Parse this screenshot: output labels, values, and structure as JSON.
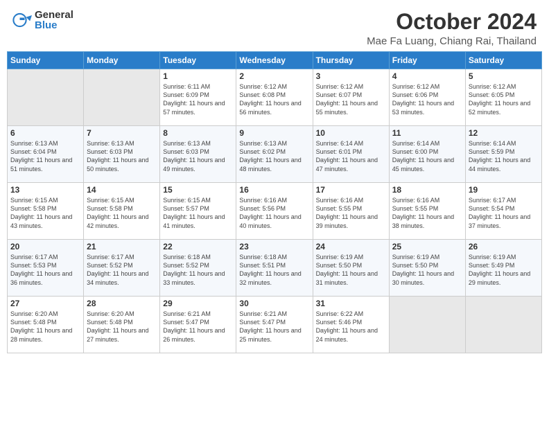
{
  "header": {
    "logo_general": "General",
    "logo_blue": "Blue",
    "title": "October 2024",
    "subtitle": "Mae Fa Luang, Chiang Rai, Thailand"
  },
  "days_of_week": [
    "Sunday",
    "Monday",
    "Tuesday",
    "Wednesday",
    "Thursday",
    "Friday",
    "Saturday"
  ],
  "weeks": [
    [
      {
        "day": null
      },
      {
        "day": null
      },
      {
        "day": "1",
        "sunrise": "Sunrise: 6:11 AM",
        "sunset": "Sunset: 6:09 PM",
        "daylight": "Daylight: 11 hours and 57 minutes."
      },
      {
        "day": "2",
        "sunrise": "Sunrise: 6:12 AM",
        "sunset": "Sunset: 6:08 PM",
        "daylight": "Daylight: 11 hours and 56 minutes."
      },
      {
        "day": "3",
        "sunrise": "Sunrise: 6:12 AM",
        "sunset": "Sunset: 6:07 PM",
        "daylight": "Daylight: 11 hours and 55 minutes."
      },
      {
        "day": "4",
        "sunrise": "Sunrise: 6:12 AM",
        "sunset": "Sunset: 6:06 PM",
        "daylight": "Daylight: 11 hours and 53 minutes."
      },
      {
        "day": "5",
        "sunrise": "Sunrise: 6:12 AM",
        "sunset": "Sunset: 6:05 PM",
        "daylight": "Daylight: 11 hours and 52 minutes."
      }
    ],
    [
      {
        "day": "6",
        "sunrise": "Sunrise: 6:13 AM",
        "sunset": "Sunset: 6:04 PM",
        "daylight": "Daylight: 11 hours and 51 minutes."
      },
      {
        "day": "7",
        "sunrise": "Sunrise: 6:13 AM",
        "sunset": "Sunset: 6:03 PM",
        "daylight": "Daylight: 11 hours and 50 minutes."
      },
      {
        "day": "8",
        "sunrise": "Sunrise: 6:13 AM",
        "sunset": "Sunset: 6:03 PM",
        "daylight": "Daylight: 11 hours and 49 minutes."
      },
      {
        "day": "9",
        "sunrise": "Sunrise: 6:13 AM",
        "sunset": "Sunset: 6:02 PM",
        "daylight": "Daylight: 11 hours and 48 minutes."
      },
      {
        "day": "10",
        "sunrise": "Sunrise: 6:14 AM",
        "sunset": "Sunset: 6:01 PM",
        "daylight": "Daylight: 11 hours and 47 minutes."
      },
      {
        "day": "11",
        "sunrise": "Sunrise: 6:14 AM",
        "sunset": "Sunset: 6:00 PM",
        "daylight": "Daylight: 11 hours and 45 minutes."
      },
      {
        "day": "12",
        "sunrise": "Sunrise: 6:14 AM",
        "sunset": "Sunset: 5:59 PM",
        "daylight": "Daylight: 11 hours and 44 minutes."
      }
    ],
    [
      {
        "day": "13",
        "sunrise": "Sunrise: 6:15 AM",
        "sunset": "Sunset: 5:58 PM",
        "daylight": "Daylight: 11 hours and 43 minutes."
      },
      {
        "day": "14",
        "sunrise": "Sunrise: 6:15 AM",
        "sunset": "Sunset: 5:58 PM",
        "daylight": "Daylight: 11 hours and 42 minutes."
      },
      {
        "day": "15",
        "sunrise": "Sunrise: 6:15 AM",
        "sunset": "Sunset: 5:57 PM",
        "daylight": "Daylight: 11 hours and 41 minutes."
      },
      {
        "day": "16",
        "sunrise": "Sunrise: 6:16 AM",
        "sunset": "Sunset: 5:56 PM",
        "daylight": "Daylight: 11 hours and 40 minutes."
      },
      {
        "day": "17",
        "sunrise": "Sunrise: 6:16 AM",
        "sunset": "Sunset: 5:55 PM",
        "daylight": "Daylight: 11 hours and 39 minutes."
      },
      {
        "day": "18",
        "sunrise": "Sunrise: 6:16 AM",
        "sunset": "Sunset: 5:55 PM",
        "daylight": "Daylight: 11 hours and 38 minutes."
      },
      {
        "day": "19",
        "sunrise": "Sunrise: 6:17 AM",
        "sunset": "Sunset: 5:54 PM",
        "daylight": "Daylight: 11 hours and 37 minutes."
      }
    ],
    [
      {
        "day": "20",
        "sunrise": "Sunrise: 6:17 AM",
        "sunset": "Sunset: 5:53 PM",
        "daylight": "Daylight: 11 hours and 36 minutes."
      },
      {
        "day": "21",
        "sunrise": "Sunrise: 6:17 AM",
        "sunset": "Sunset: 5:52 PM",
        "daylight": "Daylight: 11 hours and 34 minutes."
      },
      {
        "day": "22",
        "sunrise": "Sunrise: 6:18 AM",
        "sunset": "Sunset: 5:52 PM",
        "daylight": "Daylight: 11 hours and 33 minutes."
      },
      {
        "day": "23",
        "sunrise": "Sunrise: 6:18 AM",
        "sunset": "Sunset: 5:51 PM",
        "daylight": "Daylight: 11 hours and 32 minutes."
      },
      {
        "day": "24",
        "sunrise": "Sunrise: 6:19 AM",
        "sunset": "Sunset: 5:50 PM",
        "daylight": "Daylight: 11 hours and 31 minutes."
      },
      {
        "day": "25",
        "sunrise": "Sunrise: 6:19 AM",
        "sunset": "Sunset: 5:50 PM",
        "daylight": "Daylight: 11 hours and 30 minutes."
      },
      {
        "day": "26",
        "sunrise": "Sunrise: 6:19 AM",
        "sunset": "Sunset: 5:49 PM",
        "daylight": "Daylight: 11 hours and 29 minutes."
      }
    ],
    [
      {
        "day": "27",
        "sunrise": "Sunrise: 6:20 AM",
        "sunset": "Sunset: 5:48 PM",
        "daylight": "Daylight: 11 hours and 28 minutes."
      },
      {
        "day": "28",
        "sunrise": "Sunrise: 6:20 AM",
        "sunset": "Sunset: 5:48 PM",
        "daylight": "Daylight: 11 hours and 27 minutes."
      },
      {
        "day": "29",
        "sunrise": "Sunrise: 6:21 AM",
        "sunset": "Sunset: 5:47 PM",
        "daylight": "Daylight: 11 hours and 26 minutes."
      },
      {
        "day": "30",
        "sunrise": "Sunrise: 6:21 AM",
        "sunset": "Sunset: 5:47 PM",
        "daylight": "Daylight: 11 hours and 25 minutes."
      },
      {
        "day": "31",
        "sunrise": "Sunrise: 6:22 AM",
        "sunset": "Sunset: 5:46 PM",
        "daylight": "Daylight: 11 hours and 24 minutes."
      },
      {
        "day": null
      },
      {
        "day": null
      }
    ]
  ]
}
